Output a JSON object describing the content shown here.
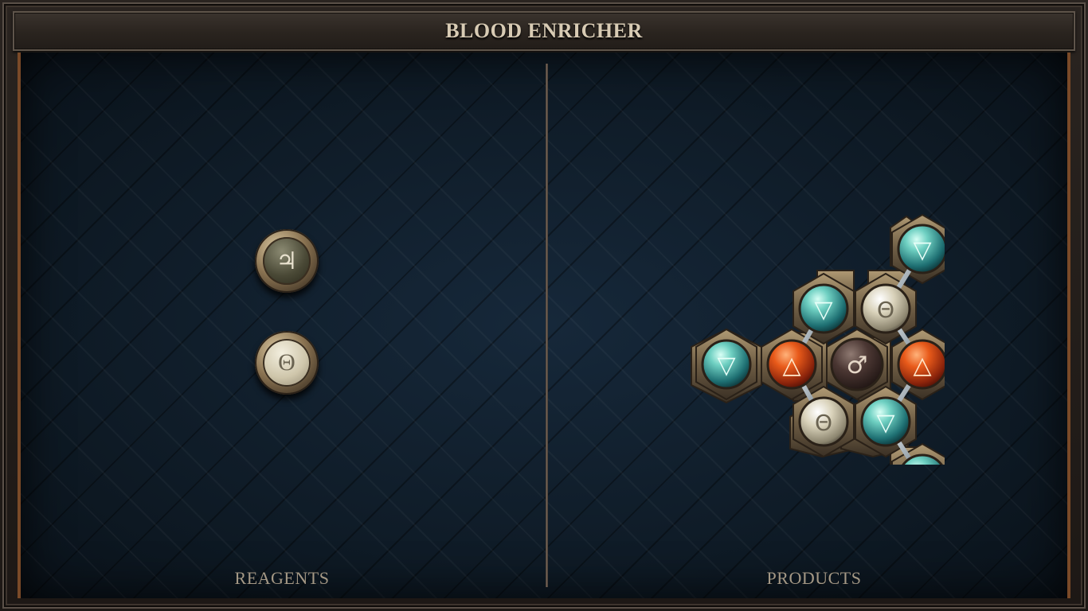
{
  "window": {
    "title": "BLOOD ENRICHER"
  },
  "panels": {
    "left_label": "REAGENTS",
    "right_label": "PRODUCTS"
  },
  "reagents": [
    {
      "symbol": "♃",
      "name": "reagent-jupiter"
    },
    {
      "symbol": "Θ",
      "name": "reagent-theta"
    }
  ],
  "product_molecule": {
    "atoms": [
      {
        "id": "top-right-water",
        "symbol": "▽",
        "element": "water",
        "color": "#4fb8b0"
      },
      {
        "id": "upper-left-water",
        "symbol": "▽",
        "element": "water",
        "color": "#4fb8b0"
      },
      {
        "id": "upper-right-salt",
        "symbol": "Θ",
        "element": "salt",
        "color": "#d7d0b8"
      },
      {
        "id": "left-water",
        "symbol": "▽",
        "element": "water",
        "color": "#4fb8b0"
      },
      {
        "id": "left-fire",
        "symbol": "△",
        "element": "fire",
        "color": "#d5521e"
      },
      {
        "id": "center-iron",
        "symbol": "♂",
        "element": "iron",
        "color": "#4a3a36"
      },
      {
        "id": "right-fire",
        "symbol": "△",
        "element": "fire",
        "color": "#d5521e"
      },
      {
        "id": "lower-left-salt",
        "symbol": "Θ",
        "element": "salt",
        "color": "#d7d0b8"
      },
      {
        "id": "lower-right-water",
        "symbol": "▽",
        "element": "water",
        "color": "#4fb8b0"
      },
      {
        "id": "bottom-right-water",
        "symbol": "▽",
        "element": "water",
        "color": "#4fb8b0"
      }
    ]
  },
  "colors": {
    "title_text": "#d8cbb4",
    "label_text": "#a49885",
    "side_trim": "#7a4a28"
  }
}
